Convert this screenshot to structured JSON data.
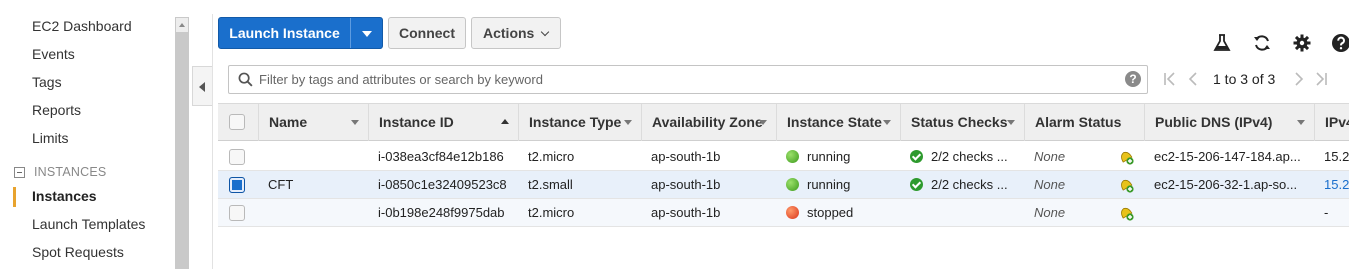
{
  "sidebar": {
    "items": [
      "EC2 Dashboard",
      "Events",
      "Tags",
      "Reports",
      "Limits"
    ],
    "section": "INSTANCES",
    "section_items": [
      "Instances",
      "Launch Templates",
      "Spot Requests"
    ],
    "active": "Instances"
  },
  "toolbar": {
    "launch_label": "Launch Instance",
    "connect_label": "Connect",
    "actions_label": "Actions",
    "icons": [
      "flask-icon",
      "refresh-icon",
      "gear-icon",
      "help-icon"
    ]
  },
  "search": {
    "placeholder": "Filter by tags and attributes or search by keyword"
  },
  "pagination": {
    "text": "1 to 3 of 3"
  },
  "table": {
    "columns": [
      "Name",
      "Instance ID",
      "Instance Type",
      "Availability Zone",
      "Instance State",
      "Status Checks",
      "Alarm Status",
      "Public DNS (IPv4)",
      "IPv4"
    ],
    "sorted_column": "Instance ID",
    "rows": [
      {
        "name": "",
        "id": "i-038ea3cf84e12b186",
        "type": "t2.micro",
        "az": "ap-south-1b",
        "state": "running",
        "checks": "2/2 checks ...",
        "alarm": "None",
        "dns": "ec2-15-206-147-184.ap...",
        "ip": "15.2",
        "selected": false
      },
      {
        "name": "CFT",
        "id": "i-0850c1e32409523c8",
        "type": "t2.small",
        "az": "ap-south-1b",
        "state": "running",
        "checks": "2/2 checks ...",
        "alarm": "None",
        "dns": "ec2-15-206-32-1.ap-so...",
        "ip": "15.2",
        "selected": true
      },
      {
        "name": "",
        "id": "i-0b198e248f9975dab",
        "type": "t2.micro",
        "az": "ap-south-1b",
        "state": "stopped",
        "checks": "",
        "alarm": "None",
        "dns": "",
        "ip": "-",
        "selected": false
      }
    ]
  },
  "colors": {
    "primary": "#1a6fcc",
    "running": "#3c9a1c",
    "stopped": "#d9341a",
    "active_marker": "#e8a32e"
  }
}
